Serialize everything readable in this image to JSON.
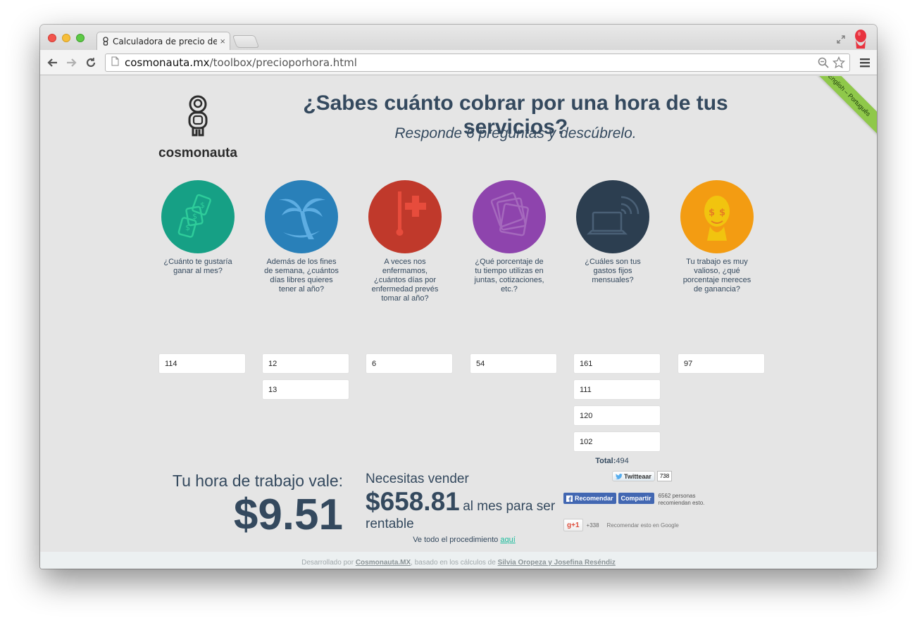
{
  "browser": {
    "tab_title": "Calculadora de precio de h",
    "tab_close": "×",
    "url_domain": "cosmonauta.mx",
    "url_path": "/toolbox/precioporhora.html"
  },
  "ribbon": {
    "label": "English – Português"
  },
  "logo": {
    "brand": "cosmonauta"
  },
  "header": {
    "title": "¿Sabes cuánto cobrar por una hora de tus servicios?",
    "subtitle": "Responde 6 preguntas y descúbrelo."
  },
  "questions": [
    {
      "text": "¿Cuánto te gustaría ganar al mes?",
      "color": "#16a085",
      "icon": "money-icon",
      "values": [
        "114"
      ]
    },
    {
      "text": "Además de los fines de semana, ¿cuántos días libres quieres tener al año?",
      "color": "#2980b9",
      "icon": "palm-tree-icon",
      "values": [
        "12",
        "13"
      ]
    },
    {
      "text": "A veces nos enfermamos, ¿cuántos días por enfermedad prevés tomar al año?",
      "color": "#c0392b",
      "icon": "thermometer-icon",
      "values": [
        "6"
      ]
    },
    {
      "text": "¿Qué porcentaje de tu tiempo utilizas en juntas, cotizaciones, etc.?",
      "color": "#8e44ad",
      "icon": "papers-icon",
      "values": [
        "54"
      ]
    },
    {
      "text": "¿Cuáles son tus gastos fijos mensuales?",
      "color": "#2c3e50",
      "icon": "laptop-wifi-icon",
      "values": [
        "161",
        "111",
        "120",
        "102"
      ]
    },
    {
      "text": "Tu trabajo es muy valioso, ¿qué porcentaje mereces de ganancia?",
      "color": "#f39c12",
      "icon": "head-dollar-icon",
      "values": [
        "97"
      ]
    }
  ],
  "total": {
    "label": "Total:",
    "value": "494"
  },
  "result": {
    "rate_label": "Tu hora de trabajo vale:",
    "rate_value": "$9.51",
    "sell_label": "Necesitas vender",
    "sell_amount": "$658.81",
    "sell_rest": "al mes para ser",
    "sell_rest2": "rentable",
    "procedure_text": "Ve todo el procedimiento",
    "procedure_link": "aquí"
  },
  "social": {
    "twitter_label": "Twitteaar",
    "twitter_count": "738",
    "fb_recommend": "Recomendar",
    "fb_share": "Compartir",
    "fb_text": "6562 personas recomiendan esto.",
    "gplus_label": "+1",
    "gplus_count": "+338",
    "gplus_text": "Recomendar esto en Google"
  },
  "footer": {
    "credits_pre": "Desarrollado por",
    "credits_brand": "Cosmonauta.MX",
    "credits_mid": ", basado en los cálculos de",
    "credits_authors": "Silvia Oropeza y Josefina Reséndiz"
  }
}
